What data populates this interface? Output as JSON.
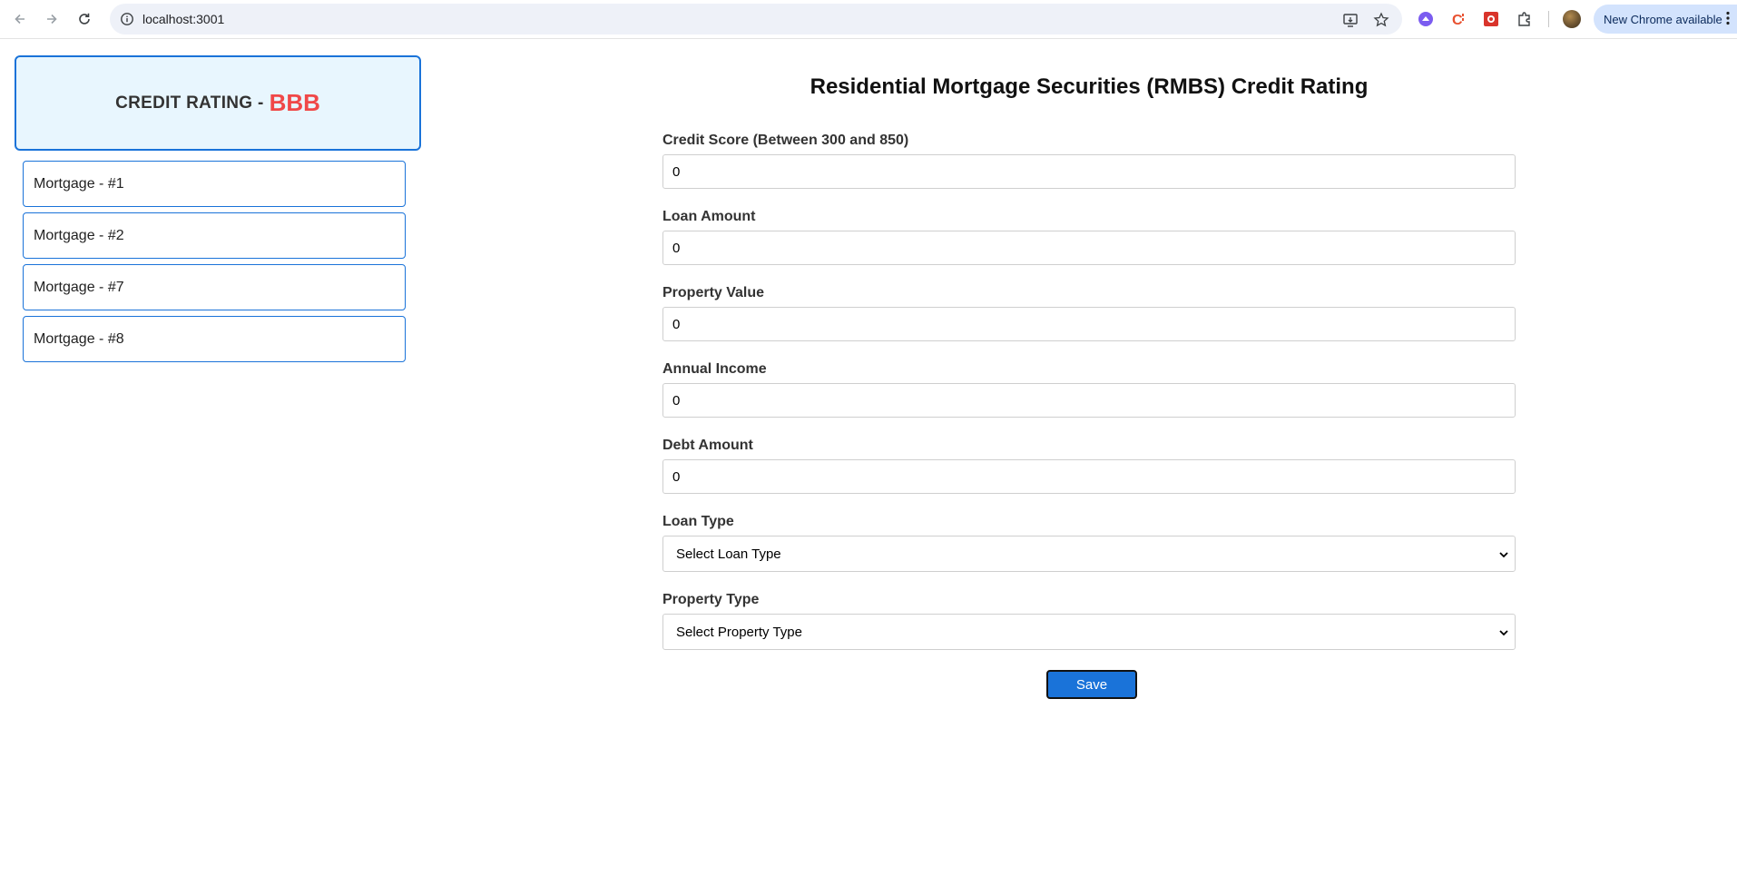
{
  "browser": {
    "url": "localhost:3001",
    "update_label": "New Chrome available"
  },
  "rating": {
    "label": "CREDIT RATING -",
    "value": "BBB",
    "value_color": "#f04848"
  },
  "mortgages": [
    {
      "label": "Mortgage - #1"
    },
    {
      "label": "Mortgage - #2"
    },
    {
      "label": "Mortgage - #7"
    },
    {
      "label": "Mortgage - #8"
    }
  ],
  "form": {
    "title": "Residential Mortgage Securities (RMBS) Credit Rating",
    "fields": [
      {
        "label": "Credit Score (Between 300 and 850)",
        "value": "0"
      },
      {
        "label": "Loan Amount",
        "value": "0"
      },
      {
        "label": "Property Value",
        "value": "0"
      },
      {
        "label": "Annual Income",
        "value": "0"
      },
      {
        "label": "Debt Amount",
        "value": "0"
      }
    ],
    "selects": [
      {
        "label": "Loan Type",
        "selected": "Select Loan Type"
      },
      {
        "label": "Property Type",
        "selected": "Select Property Type"
      }
    ],
    "save_label": "Save"
  },
  "colors": {
    "accent": "#1a73d9",
    "card_bg": "#e8f6fe"
  }
}
